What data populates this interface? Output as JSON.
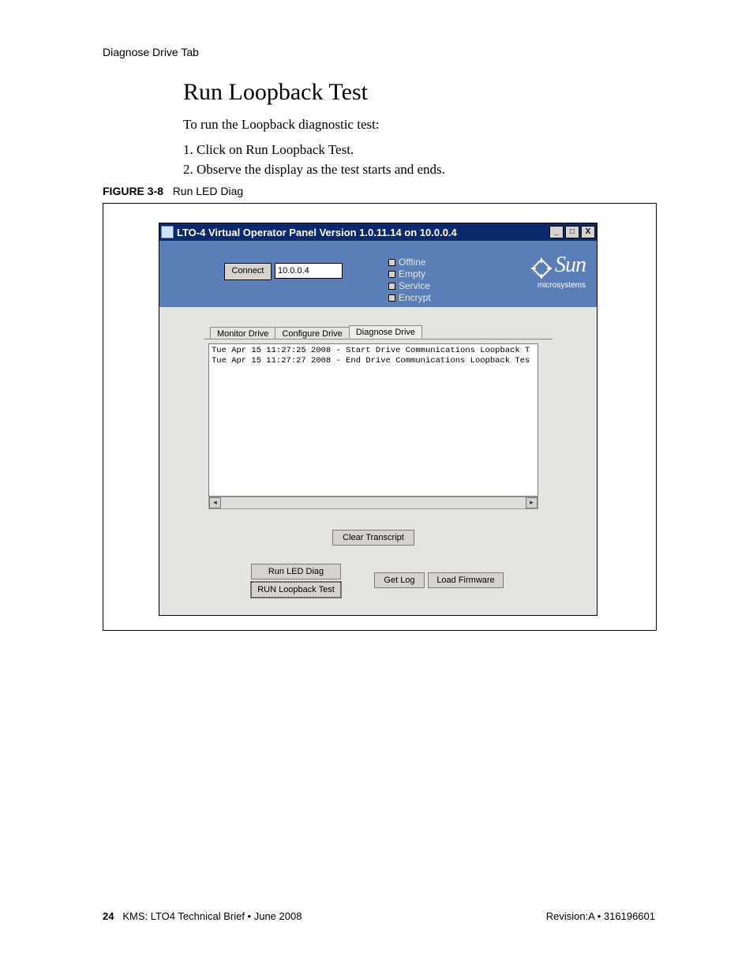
{
  "breadcrumb": "Diagnose Drive Tab",
  "heading": "Run Loopback Test",
  "intro": "To run the Loopback diagnostic test:",
  "steps": {
    "s1": "1. Click on Run Loopback Test.",
    "s2": "2. Observe the display as the test starts and ends."
  },
  "figure": {
    "label": "FIGURE 3-8",
    "caption": "Run LED Diag"
  },
  "app": {
    "title": "LTO-4 Virtual Operator Panel Version 1.0.11.14 on 10.0.0.4",
    "win_min": "_",
    "win_max": "□",
    "win_close": "X",
    "connect_label": "Connect",
    "ip_value": "10.0.0.4",
    "status": {
      "offline": "Offline",
      "empty": "Empty",
      "service": "Service",
      "encrypt": "Encrypt"
    },
    "logo": {
      "sun": "Sun",
      "ms": "microsystems"
    },
    "tabs": {
      "monitor": "Monitor Drive",
      "configure": "Configure Drive",
      "diagnose": "Diagnose Drive"
    },
    "transcript": {
      "l1": "Tue Apr 15 11:27:25 2008 - Start Drive Communications Loopback T",
      "l2": "Tue Apr 15 11:27:27 2008 - End Drive Communications Loopback Tes"
    },
    "scroll": {
      "left": "◂",
      "right": "▸"
    },
    "buttons": {
      "clear": "Clear Transcript",
      "led": "Run LED Diag",
      "loop": "RUN Loopback Test",
      "log": "Get Log",
      "fw": "Load Firmware"
    }
  },
  "footer": {
    "page": "24",
    "doc": "KMS: LTO4 Technical Brief  •  June 2008",
    "rev": "Revision:A  •  316196601"
  }
}
